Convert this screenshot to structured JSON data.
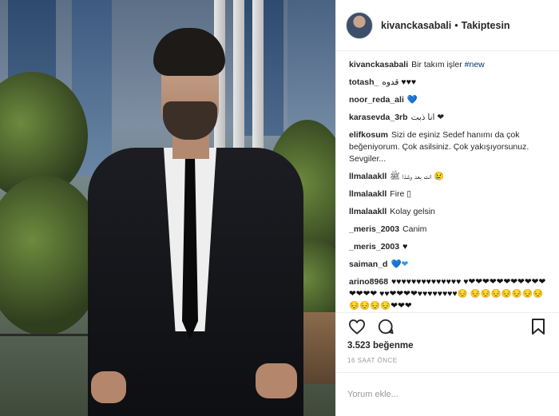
{
  "header": {
    "username": "kivanckasabali",
    "separator": "•",
    "follow_status": "Takiptesin"
  },
  "comments": [
    {
      "user": "kivanckasabali",
      "text": "Bir takım işler",
      "tag": "#new"
    },
    {
      "user": "totash_",
      "text": "قدوه ♥♥♥"
    },
    {
      "user": "noor_reda_ali",
      "text": "💙"
    },
    {
      "user": "karasevda_3rb",
      "text": "انا ذبت ❤"
    },
    {
      "user": "elifkosum",
      "text": "Sizi de eşiniz Sedef hanımı da çok beğeniyorum. Çok asilsiniz. Çok yakışıyorsunuz. Sevgiler..."
    },
    {
      "user": "llmalaakll",
      "text": "انت بعد وشذا ﷺ 😢"
    },
    {
      "user": "llmalaakll",
      "text": "Fire ▯"
    },
    {
      "user": "llmalaakll",
      "text": "Kolay gelsin"
    },
    {
      "user": "_meris_2003",
      "text": "Canim"
    },
    {
      "user": "_meris_2003",
      "text": "♥"
    },
    {
      "user": "saiman_d",
      "text": "💙❤"
    },
    {
      "user": "arino8968",
      "text": "♥♥♥♥♥♥♥♥♥♥♥♥♥♥ ♥❤❤❤❤❤❤❤❤❤❤❤❤❤❤❤ ♥♥❤❤❤❤♥♥♥♥♥♥♥♥😔 😔😔😔😔😔😔😔😔😔😔😔❤❤❤"
    }
  ],
  "actions": {
    "like_icon": "heart-outline-icon",
    "comment_icon": "comment-bubble-icon",
    "save_icon": "bookmark-icon"
  },
  "likes_text": "3.523 beğenme",
  "timestamp": "16 SAAT ÖNCE",
  "comment_input": {
    "placeholder": "Yorum ekle..."
  }
}
